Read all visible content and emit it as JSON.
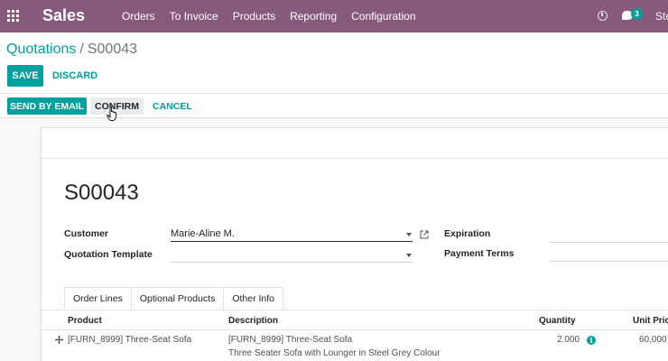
{
  "navbar": {
    "app_name": "Sales",
    "menu": [
      "Orders",
      "To Invoice",
      "Products",
      "Reporting",
      "Configuration"
    ],
    "message_count": "3",
    "user_name": "Ste",
    "color": "#875a7b"
  },
  "breadcrumb": {
    "parent": "Quotations",
    "separator": "/",
    "current": "S00043"
  },
  "control_panel": {
    "save_label": "SAVE",
    "discard_label": "DISCARD"
  },
  "statusbar": {
    "send_email_label": "SEND BY EMAIL",
    "confirm_label": "CONFIRM",
    "cancel_label": "CANCEL"
  },
  "form": {
    "name": "S00043",
    "customer_label": "Customer",
    "customer_value": "Marie-Aline M.",
    "template_label": "Quotation Template",
    "template_value": "",
    "expiration_label": "Expiration",
    "expiration_value": "",
    "payment_terms_label": "Payment Terms",
    "payment_terms_value": ""
  },
  "tabs": [
    "Order Lines",
    "Optional Products",
    "Other Info"
  ],
  "order_lines": {
    "columns": [
      "Product",
      "Description",
      "Quantity",
      "Unit Pric"
    ],
    "rows": [
      {
        "product": "[FURN_8999] Three-Seat Sofa",
        "description_line1": "[FURN_8999] Three-Seat Sofa",
        "description_line2": "Three Seater Sofa with Lounger in Steel Grey Colour",
        "quantity": "2.000",
        "unit_price": "60,000"
      }
    ]
  },
  "accent_color": "#00a09d"
}
